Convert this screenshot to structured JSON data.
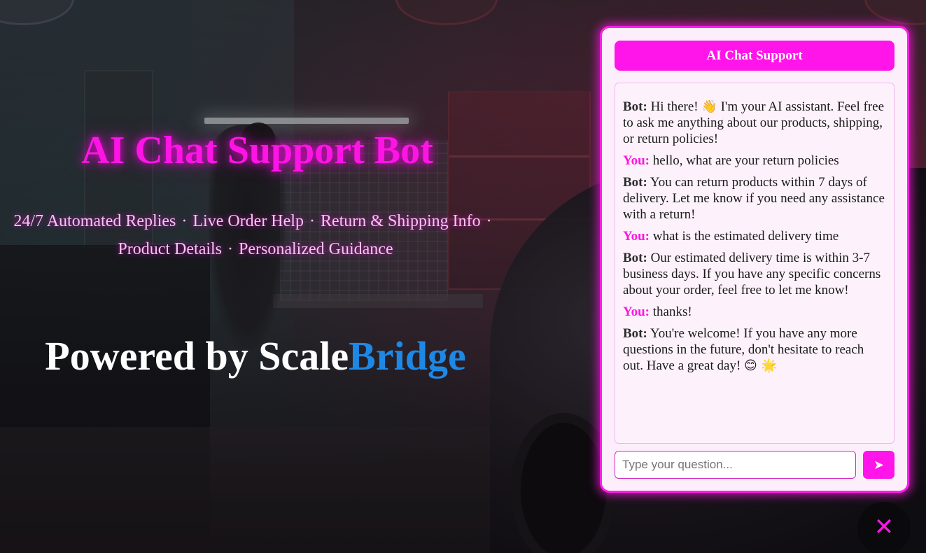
{
  "hero": {
    "title": "AI Chat Support Bot",
    "features": [
      "24/7 Automated Replies",
      "Live Order Help",
      "Return & Shipping Info",
      "Product Details",
      "Personalized Guidance"
    ],
    "separator": "·",
    "powered_prefix": "Powered by ",
    "brand_part1": "Scale",
    "brand_part2": "Bridge"
  },
  "chat": {
    "header_title": "AI Chat Support",
    "bot_label": "Bot:",
    "user_label": "You:",
    "messages": [
      {
        "sender": "bot",
        "text": "Hi there! ",
        "emoji": "👋",
        "text_after": " I'm your AI assistant. Feel free to ask me anything about our products, shipping, or return policies!"
      },
      {
        "sender": "user",
        "text": "hello, what are your return policies"
      },
      {
        "sender": "bot",
        "text": "You can return products within 7 days of delivery. Let me know if you need any assistance with a return!"
      },
      {
        "sender": "user",
        "text": "what is the estimated delivery time"
      },
      {
        "sender": "bot",
        "text": "Our estimated delivery time is within 3-7 business days. If you have any specific concerns about your order, feel free to let me know!"
      },
      {
        "sender": "user",
        "text": "thanks!"
      },
      {
        "sender": "bot",
        "text": "You're welcome! If you have any more questions in the future, don't hesitate to reach out. Have a great day! ",
        "emoji": "😊 🌟"
      }
    ],
    "input": {
      "value": "",
      "placeholder": "Type your question..."
    },
    "send_icon": "➤",
    "close_icon": "✕"
  },
  "colors": {
    "accent": "#ff14e9",
    "brand_blue": "#1e88e5",
    "panel_bg": "#fdeefc"
  }
}
